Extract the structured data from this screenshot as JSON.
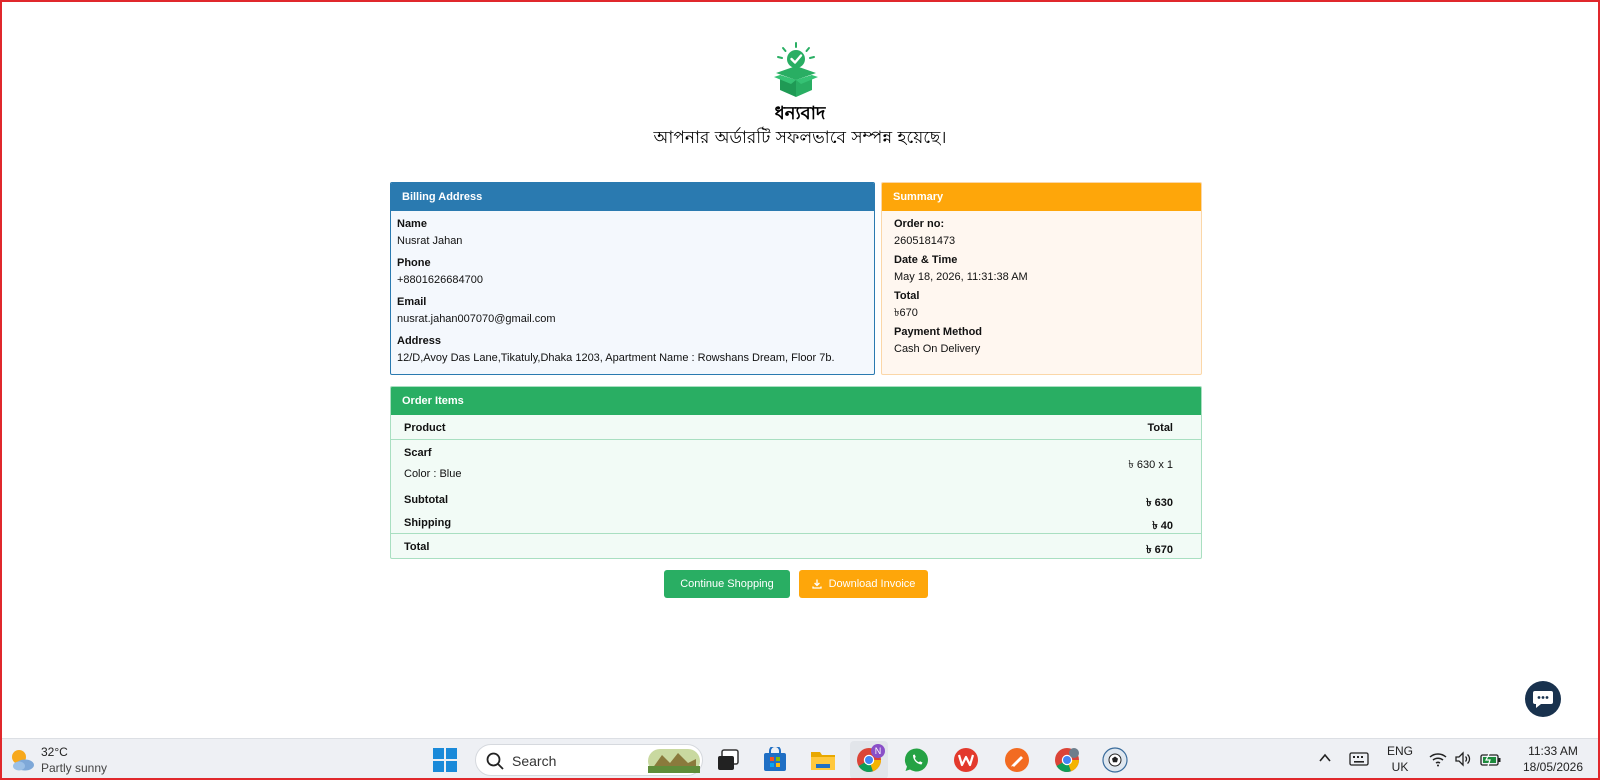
{
  "thanks": {
    "title": "ধন্যবাদ",
    "subtitle": "আপনার অর্ডারটি সফলভাবে সম্পন্ন হয়েছে।"
  },
  "billing": {
    "header": "Billing Address",
    "fields": [
      {
        "label": "Name",
        "value": "Nusrat Jahan"
      },
      {
        "label": "Phone",
        "value": "+8801626684700"
      },
      {
        "label": "Email",
        "value": "nusrat.jahan007070@gmail.com"
      },
      {
        "label": "Address",
        "value": "12/D,Avoy Das Lane,Tikatuly,Dhaka 1203, Apartment Name : Rowshans Dream, Floor 7b."
      }
    ]
  },
  "summary": {
    "header": "Summary",
    "fields": [
      {
        "label": "Order no:",
        "value": "2605181473"
      },
      {
        "label": "Date & Time",
        "value": "May 18, 2026, 11:31:38 AM"
      },
      {
        "label": "Total",
        "value": "৳670"
      },
      {
        "label": "Payment Method",
        "value": "Cash On Delivery"
      }
    ]
  },
  "order_items": {
    "header": "Order Items",
    "col_product": "Product",
    "col_total": "Total",
    "items": [
      {
        "name": "Scarf",
        "variant": "Color : Blue",
        "price": "৳ 630 x 1"
      }
    ],
    "subtotal_label": "Subtotal",
    "subtotal_value": "৳ 630",
    "shipping_label": "Shipping",
    "shipping_value": "৳ 40",
    "total_label": "Total",
    "total_value": "৳ 670"
  },
  "actions": {
    "continue_label": "Continue Shopping",
    "download_label": "Download Invoice"
  },
  "colors": {
    "billing_header": "#2a7ab0",
    "summary_header": "#fea60a",
    "items_header": "#29ae63",
    "continue_button": "#29ae63",
    "download_button": "#fea60a",
    "chat_button": "#19324e"
  },
  "taskbar": {
    "weather_temp": "32°C",
    "weather_desc": "Partly sunny",
    "search_label": "Search",
    "lang_primary": "ENG",
    "lang_secondary": "UK",
    "time": "11:33 AM",
    "date": "18/05/2026",
    "chrome_badge": "N"
  }
}
